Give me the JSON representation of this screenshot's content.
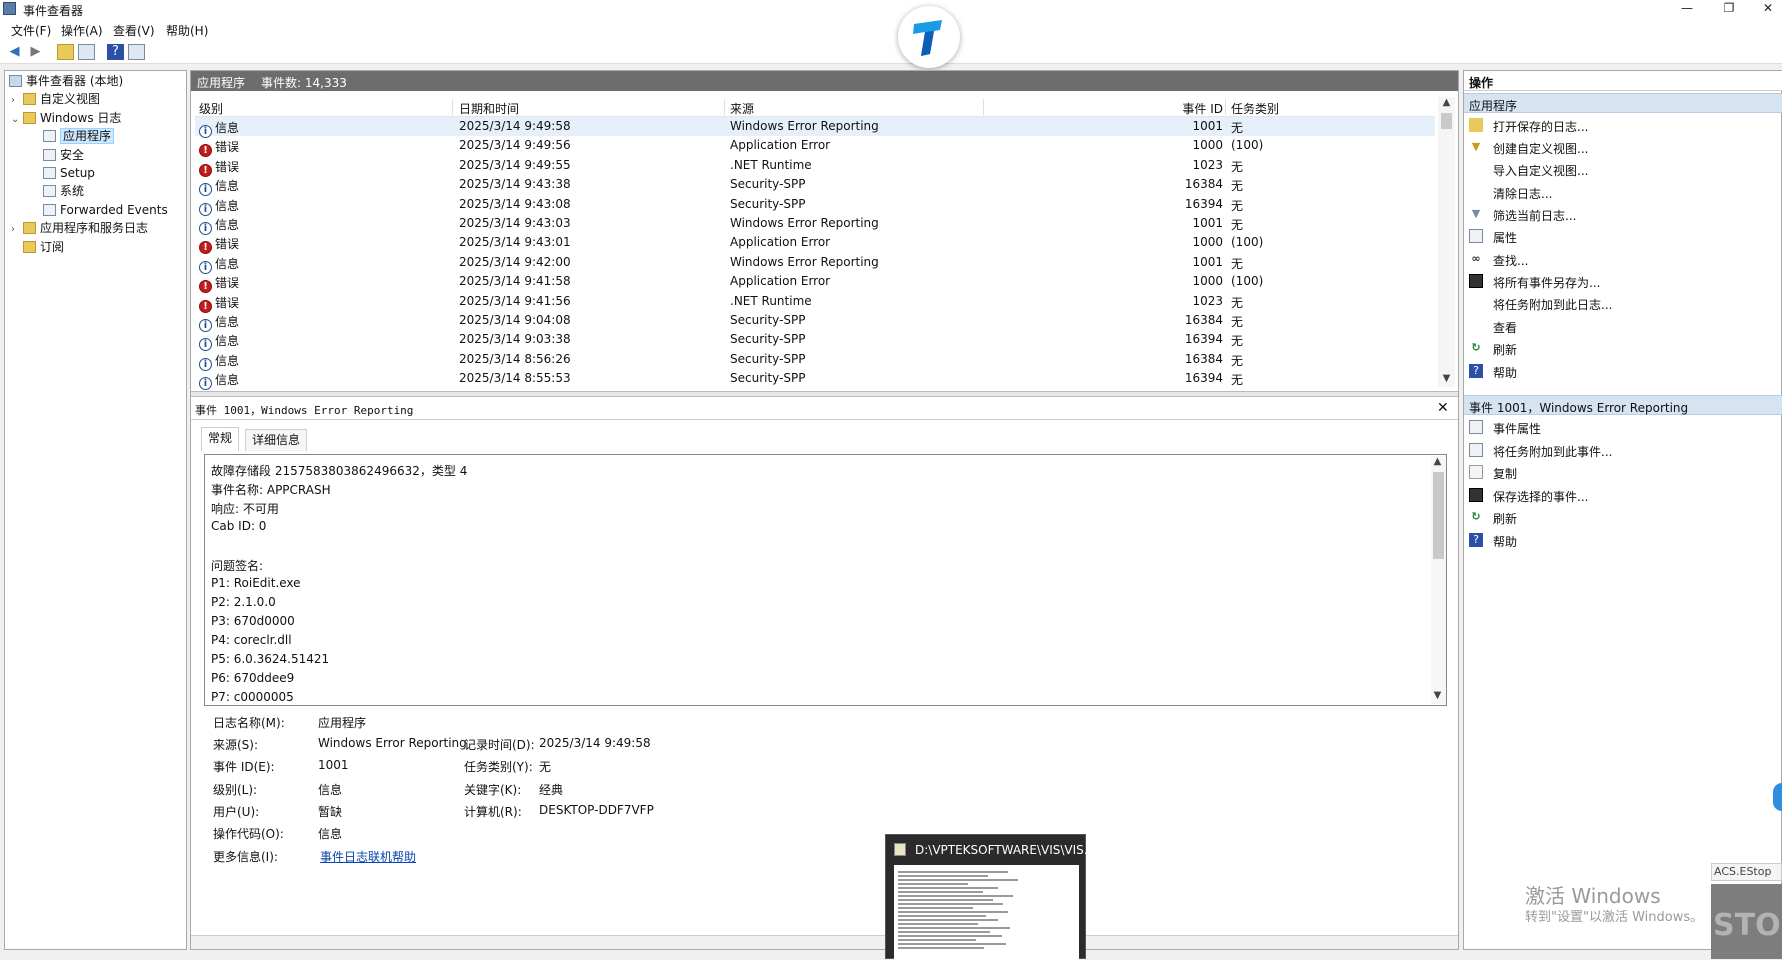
{
  "window": {
    "title": "事件查看器",
    "minimize": "—",
    "maximize": "❐",
    "close": "✕"
  },
  "menu": [
    "文件(F)",
    "操作(A)",
    "查看(V)",
    "帮助(H)"
  ],
  "tree": {
    "root": "事件查看器 (本地)",
    "custom_views": "自定义视图",
    "windows_logs": "Windows 日志",
    "children": [
      "应用程序",
      "安全",
      "Setup",
      "系统",
      "Forwarded Events"
    ],
    "app_service_logs": "应用程序和服务日志",
    "subscriptions": "订阅"
  },
  "list": {
    "title": "应用程序",
    "count": "事件数: 14,333",
    "columns": [
      "级别",
      "日期和时间",
      "来源",
      "事件 ID",
      "任务类别"
    ],
    "rows": [
      {
        "level": "信息",
        "type": "info",
        "date": "2025/3/14 9:49:58",
        "source": "Windows Error Reporting",
        "id": "1001",
        "task": "无"
      },
      {
        "level": "错误",
        "type": "error",
        "date": "2025/3/14 9:49:56",
        "source": "Application Error",
        "id": "1000",
        "task": "(100)"
      },
      {
        "level": "错误",
        "type": "error",
        "date": "2025/3/14 9:49:55",
        "source": ".NET Runtime",
        "id": "1023",
        "task": "无"
      },
      {
        "level": "信息",
        "type": "info",
        "date": "2025/3/14 9:43:38",
        "source": "Security-SPP",
        "id": "16384",
        "task": "无"
      },
      {
        "level": "信息",
        "type": "info",
        "date": "2025/3/14 9:43:08",
        "source": "Security-SPP",
        "id": "16394",
        "task": "无"
      },
      {
        "level": "信息",
        "type": "info",
        "date": "2025/3/14 9:43:03",
        "source": "Windows Error Reporting",
        "id": "1001",
        "task": "无"
      },
      {
        "level": "错误",
        "type": "error",
        "date": "2025/3/14 9:43:01",
        "source": "Application Error",
        "id": "1000",
        "task": "(100)"
      },
      {
        "level": "信息",
        "type": "info",
        "date": "2025/3/14 9:42:00",
        "source": "Windows Error Reporting",
        "id": "1001",
        "task": "无"
      },
      {
        "level": "错误",
        "type": "error",
        "date": "2025/3/14 9:41:58",
        "source": "Application Error",
        "id": "1000",
        "task": "(100)"
      },
      {
        "level": "错误",
        "type": "error",
        "date": "2025/3/14 9:41:56",
        "source": ".NET Runtime",
        "id": "1023",
        "task": "无"
      },
      {
        "level": "信息",
        "type": "info",
        "date": "2025/3/14 9:04:08",
        "source": "Security-SPP",
        "id": "16384",
        "task": "无"
      },
      {
        "level": "信息",
        "type": "info",
        "date": "2025/3/14 9:03:38",
        "source": "Security-SPP",
        "id": "16394",
        "task": "无"
      },
      {
        "level": "信息",
        "type": "info",
        "date": "2025/3/14 8:56:26",
        "source": "Security-SPP",
        "id": "16384",
        "task": "无"
      },
      {
        "level": "信息",
        "type": "info",
        "date": "2025/3/14 8:55:53",
        "source": "Security-SPP",
        "id": "16394",
        "task": "无"
      }
    ]
  },
  "detail": {
    "title": "事件 1001，Windows Error Reporting",
    "close": "✕",
    "tabs": [
      "常规",
      "详细信息"
    ],
    "description": [
      "故障存储段 2157583803862496632，类型 4",
      "事件名称: APPCRASH",
      "响应: 不可用",
      "Cab ID: 0",
      "",
      "问题签名:",
      "P1: RoiEdit.exe",
      "P2: 2.1.0.0",
      "P3: 670d0000",
      "P4: coreclr.dll",
      "P5: 6.0.3624.51421",
      "P6: 670ddee9",
      "P7: c0000005"
    ],
    "props": {
      "log_name_label": "日志名称(M):",
      "log_name": "应用程序",
      "source_label": "来源(S):",
      "source": "Windows Error Reporting",
      "logged_label": "记录时间(D):",
      "logged": "2025/3/14 9:49:58",
      "event_id_label": "事件 ID(E):",
      "event_id": "1001",
      "task_label": "任务类别(Y):",
      "task": "无",
      "level_label": "级别(L):",
      "level": "信息",
      "keywords_label": "关键字(K):",
      "keywords": "经典",
      "user_label": "用户(U):",
      "user": "暂缺",
      "computer_label": "计算机(R):",
      "computer": "DESKTOP-DDF7VFP",
      "opcode_label": "操作代码(O):",
      "opcode": "信息",
      "more_info_label": "更多信息(I):",
      "more_info": "事件日志联机帮助"
    }
  },
  "actions": {
    "header": "操作",
    "section1": "应用程序",
    "items1": [
      {
        "icon": "open-icon",
        "label": "打开保存的日志..."
      },
      {
        "icon": "filter-icon",
        "label": "创建自定义视图..."
      },
      {
        "icon": "",
        "label": "导入自定义视图..."
      },
      {
        "icon": "",
        "label": "清除日志..."
      },
      {
        "icon": "filter-icon",
        "label": "筛选当前日志..."
      },
      {
        "icon": "properties-icon",
        "label": "属性"
      },
      {
        "icon": "find-icon",
        "label": "查找..."
      },
      {
        "icon": "save-icon",
        "label": "将所有事件另存为..."
      },
      {
        "icon": "",
        "label": "将任务附加到此日志..."
      },
      {
        "icon": "",
        "label": "查看"
      },
      {
        "icon": "refresh-icon",
        "label": "刷新"
      },
      {
        "icon": "help-icon",
        "label": "帮助"
      }
    ],
    "section2": "事件 1001，Windows Error Reporting",
    "items2": [
      {
        "icon": "properties-icon",
        "label": "事件属性"
      },
      {
        "icon": "task-icon",
        "label": "将任务附加到此事件..."
      },
      {
        "icon": "copy-icon",
        "label": "复制"
      },
      {
        "icon": "save-icon",
        "label": "保存选择的事件..."
      },
      {
        "icon": "refresh-icon",
        "label": "刷新"
      },
      {
        "icon": "help-icon",
        "label": "帮助"
      }
    ]
  },
  "thumbnail": {
    "title": "D:\\VPTEKSOFTWARE\\VIS\\VIS..."
  },
  "watermark": {
    "line1": "激活 Windows",
    "line2": "转到\"设置\"以激活 Windows。"
  },
  "acs": {
    "label": "ACS.EStop",
    "stop": "STOP"
  },
  "colors": {
    "header_bar": "#6d6d6d",
    "action_section": "#d6e3f1",
    "error": "#c21d1d",
    "info": "#1f4f8a",
    "link": "#0645ad"
  }
}
